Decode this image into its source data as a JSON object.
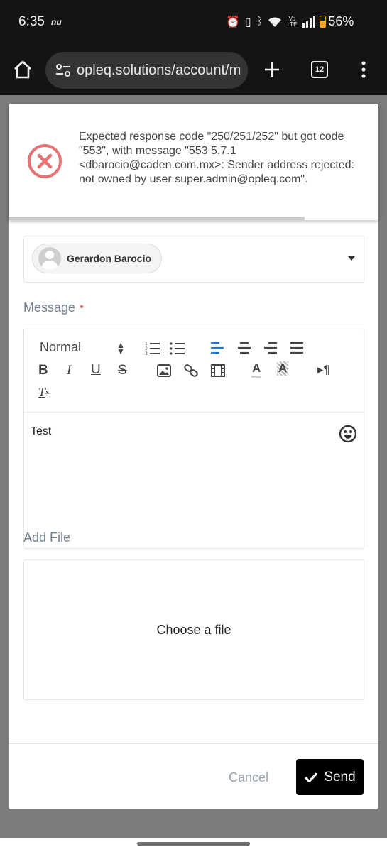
{
  "status_bar": {
    "time": "6:35",
    "carrier_icon_text": "nu",
    "volte": "Vo LTE",
    "battery": "56%",
    "icons": [
      "alarm-icon",
      "vibrate-icon",
      "bluetooth-icon",
      "wifi-icon",
      "signal-icon",
      "battery-icon"
    ]
  },
  "browser": {
    "url": "opleq.solutions/account/m",
    "tab_count": "12",
    "icons": [
      "home-icon",
      "site-info-icon",
      "new-tab-icon",
      "tabs-icon",
      "menu-icon"
    ]
  },
  "toast": {
    "message": "Expected response code \"250/251/252\" but got code \"553\", with message \"553 5.7.1 <dbarocio@caden.com.mx>: Sender address rejected: not owned by user super.admin@opleq.com\".",
    "color": "#e57373",
    "progress": 0.8
  },
  "recipient": {
    "name": "Gerardon Barocio"
  },
  "message_label": "Message",
  "required_mark": "*",
  "editor": {
    "format_value": "Normal",
    "content": "Test",
    "active_color": "#1a73e8"
  },
  "add_file_label": "Add File",
  "file_drop_text": "Choose a file",
  "buttons": {
    "cancel": "Cancel",
    "send": "Send"
  }
}
